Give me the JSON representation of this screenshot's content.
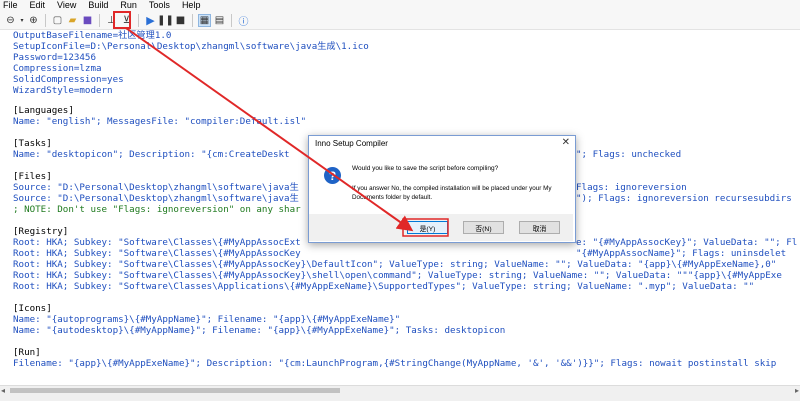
{
  "menu": {
    "file": "File",
    "edit": "Edit",
    "view": "View",
    "build": "Build",
    "run": "Run",
    "tools": "Tools",
    "help": "Help"
  },
  "toolbar_icons": [
    "back-icon",
    "new-file-icon",
    "open-folder-icon",
    "save-icon",
    "compile-icon",
    "stop-compile-icon",
    "run-icon",
    "pause-icon",
    "terminate-icon",
    "target-setup-icon",
    "target-uninstall-icon",
    "help-icon"
  ],
  "editor": {
    "l1": "OutputBaseFilename=社区管理1.0",
    "l2": "SetupIconFile=D:\\Personal\\Desktop\\zhangml\\software\\java生成\\1.ico",
    "l3": "Password=123456",
    "l4": "Compression=lzma",
    "l5": "SolidCompression=yes",
    "l6": "WizardStyle=modern",
    "languages_header": "[Languages]",
    "languages_line": "Name: \"english\"; MessagesFile: \"compiler:Default.isl\"",
    "tasks_header": "[Tasks]",
    "tasks_line_a": "Name: \"desktopicon\"; Description: \"{cm:CreateDeskt",
    "tasks_line_b": "\"; Flags: unchecked",
    "files_header": "[Files]",
    "files_line1_a": "Source: \"D:\\Personal\\Desktop\\zhangml\\software\\java生",
    "files_line1_b": "Flags: ignoreversion",
    "files_line2_a": "Source: \"D:\\Personal\\Desktop\\zhangml\\software\\java生",
    "files_line2_b": "\"); Flags: ignoreversion recursesubdirs",
    "files_comment": "; NOTE: Don't use \"Flags: ignoreversion\" on any shar",
    "registry_header": "[Registry]",
    "reg1_a": "Root: HKA; Subkey: \"Software\\Classes\\{#MyAppAssocExt",
    "reg1_b": "e: \"{#MyAppAssocKey}\"; ValueData: \"\"; Fl",
    "reg2_a": "Root: HKA; Subkey: \"Software\\Classes\\{#MyAppAssocKey",
    "reg2_b": "\"{#MyAppAssocName}\"; Flags: uninsdelet",
    "reg3": "Root: HKA; Subkey: \"Software\\Classes\\{#MyAppAssocKey}\\DefaultIcon\"; ValueType: string; ValueName: \"\"; ValueData: \"{app}\\{#MyAppExeName},0\"",
    "reg4": "Root: HKA; Subkey: \"Software\\Classes\\{#MyAppAssocKey}\\shell\\open\\command\"; ValueType: string; ValueName: \"\"; ValueData: \"\"\"{app}\\{#MyAppExe",
    "reg5": "Root: HKA; Subkey: \"Software\\Classes\\Applications\\{#MyAppExeName}\\SupportedTypes\"; ValueType: string; ValueName: \".myp\"; ValueData: \"\"",
    "icons_header": "[Icons]",
    "icons1": "Name: \"{autoprograms}\\{#MyAppName}\"; Filename: \"{app}\\{#MyAppExeName}\"",
    "icons2": "Name: \"{autodesktop}\\{#MyAppName}\"; Filename: \"{app}\\{#MyAppExeName}\"; Tasks: desktopicon",
    "run_header": "[Run]",
    "run1": "Filename: \"{app}\\{#MyAppExeName}\"; Description: \"{cm:LaunchProgram,{#StringChange(MyAppName, '&', '&&')}}\"; Flags: nowait postinstall skip"
  },
  "dialog": {
    "title": "Inno Setup Compiler",
    "close": "✕",
    "question_icon": "?",
    "message": "Would you like to save the script before compiling?",
    "detail": "If you answer No, the compiled installation will be placed under your My Documents folder by default.",
    "yes": "是(Y)",
    "no": "否(N)",
    "cancel": "取消"
  },
  "colors": {
    "annotation_red": "#e02828",
    "keyword_blue": "#1f4fbf",
    "comment_green": "#1f7a1f"
  }
}
